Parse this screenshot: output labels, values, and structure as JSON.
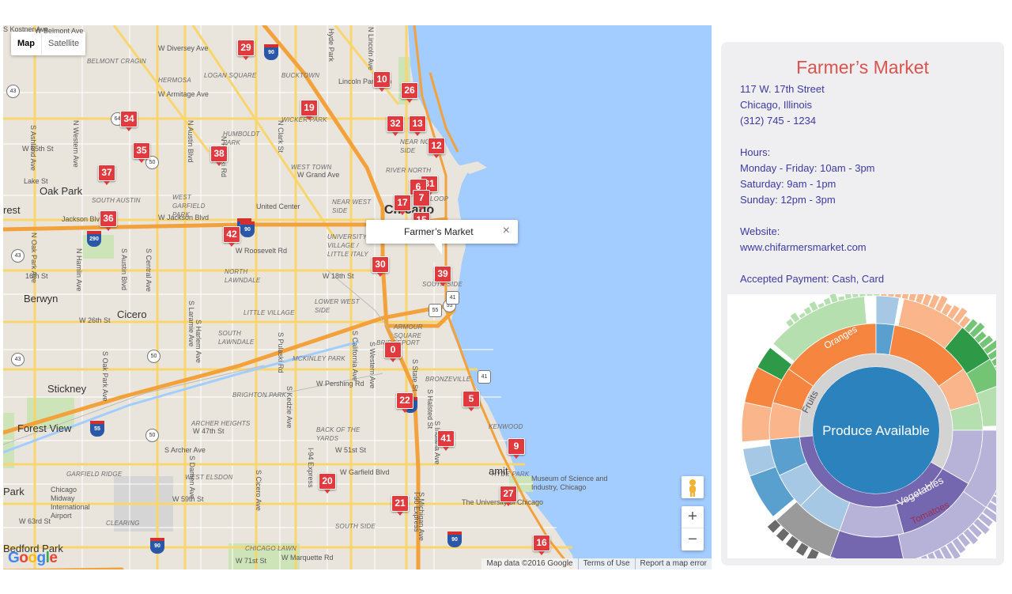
{
  "map": {
    "type_controls": {
      "map": "Map",
      "satellite": "Satellite"
    },
    "infowindow": {
      "title": "Farmer’s Market",
      "close": "×"
    },
    "zoom_in": "+",
    "zoom_out": "−",
    "footer": {
      "data": "Map data ©2016 Google",
      "terms": "Terms of Use",
      "report": "Report a map error"
    },
    "logo": "Google",
    "places": [
      {
        "t": "W Belmont Ave",
        "c": "md"
      },
      {
        "t": "W Diversey Ave",
        "c": "md"
      },
      {
        "t": "BELMONT CRAGIN",
        "c": "sm"
      },
      {
        "t": "HERMOSA",
        "c": "sm"
      },
      {
        "t": "LOGAN SQUARE",
        "c": "sm"
      },
      {
        "t": "BUCKTOWN",
        "c": "sm"
      },
      {
        "t": "W Armitage Ave",
        "c": "md"
      },
      {
        "t": "Lincoln Park Zoo",
        "c": "md"
      },
      {
        "t": "WICKER PARK",
        "c": "sm"
      },
      {
        "t": "HUMBOLDT PARK",
        "c": "sm"
      },
      {
        "t": "NEAR NORTH SIDE",
        "c": "sm"
      },
      {
        "t": "WEST TOWN",
        "c": "sm"
      },
      {
        "t": "W Grand Ave",
        "c": "md"
      },
      {
        "t": "RIVER NORTH",
        "c": "sm"
      },
      {
        "t": "Oak Park",
        "c": "lg"
      },
      {
        "t": "Lake St",
        "c": "md"
      },
      {
        "t": "SOUTH AUSTIN",
        "c": "sm"
      },
      {
        "t": "WEST GARFIELD PARK",
        "c": "sm"
      },
      {
        "t": "United Center",
        "c": "md"
      },
      {
        "t": "NEAR WEST SIDE",
        "c": "sm"
      },
      {
        "t": "Chicago",
        "c": "xl"
      },
      {
        "t": "LOOP",
        "c": "sm"
      },
      {
        "t": "Jackson Blvd",
        "c": "md"
      },
      {
        "t": "W Jackson Blvd",
        "c": "md"
      },
      {
        "t": "UNIVERSITY VILLAGE / LITTLE ITALY",
        "c": "sm"
      },
      {
        "t": "W Roosevelt Rd",
        "c": "md"
      },
      {
        "t": "NORTH LAWNDALE",
        "c": "sm"
      },
      {
        "t": "16th St",
        "c": "md"
      },
      {
        "t": "W 18th St",
        "c": "md"
      },
      {
        "t": "SOUTH SIDE",
        "c": "sm"
      },
      {
        "t": "Berwyn",
        "c": "lg"
      },
      {
        "t": "LOWER WEST SIDE",
        "c": "sm"
      },
      {
        "t": "W 26th St",
        "c": "md"
      },
      {
        "t": "Cicero",
        "c": "lg"
      },
      {
        "t": "LITTLE VILLAGE",
        "c": "sm"
      },
      {
        "t": "SOUTH LAWNDALE",
        "c": "sm"
      },
      {
        "t": "ARMOUR SQUARE",
        "c": "sm"
      },
      {
        "t": "BRIDGEPORT",
        "c": "sm"
      },
      {
        "t": "MCKINLEY PARK",
        "c": "sm"
      },
      {
        "t": "W Pershing Rd",
        "c": "md"
      },
      {
        "t": "BRONZEVILLE",
        "c": "sm"
      },
      {
        "t": "Stickney",
        "c": "lg"
      },
      {
        "t": "BRIGHTON PARK",
        "c": "sm"
      },
      {
        "t": "ARCHER HEIGHTS",
        "c": "sm"
      },
      {
        "t": "W 47th St",
        "c": "md"
      },
      {
        "t": "BACK OF THE YARDS",
        "c": "sm"
      },
      {
        "t": "Forest View",
        "c": "lg"
      },
      {
        "t": "S Archer Ave",
        "c": "md"
      },
      {
        "t": "W 51st St",
        "c": "md"
      },
      {
        "t": "KENWOOD",
        "c": "sm"
      },
      {
        "t": "GARFIELD RIDGE",
        "c": "sm"
      },
      {
        "t": "WEST ELSDON",
        "c": "sm"
      },
      {
        "t": "W Garfield Blvd",
        "c": "md"
      },
      {
        "t": "HYDE PARK",
        "c": "sm"
      },
      {
        "t": "Chicago Midway International Airport",
        "c": "md"
      },
      {
        "t": "W 59th St",
        "c": "md"
      },
      {
        "t": "Museum of Science and Industry, Chicago",
        "c": "md"
      },
      {
        "t": "The University of Chicago",
        "c": "md"
      },
      {
        "t": "W 63rd St",
        "c": "md"
      },
      {
        "t": "CLEARING",
        "c": "sm"
      },
      {
        "t": "SOUTH SIDE",
        "c": "sm"
      },
      {
        "t": "W Marquette Rd",
        "c": "md"
      },
      {
        "t": "CHICAGO LAWN",
        "c": "sm"
      },
      {
        "t": "W 71st St",
        "c": "md"
      },
      {
        "t": "Bedford Park",
        "c": "lg"
      },
      {
        "t": "W 65th St",
        "c": "md"
      },
      {
        "t": "rest",
        "c": "lg"
      },
      {
        "t": "Park",
        "c": "lg"
      },
      {
        "t": "amit",
        "c": "lg"
      },
      {
        "t": "Hyde Park",
        "c": "md"
      },
      {
        "t": "N Lincoln Ave",
        "c": "md"
      },
      {
        "t": "N Clark St",
        "c": "md"
      },
      {
        "t": "N Western Ave",
        "c": "md"
      },
      {
        "t": "N Austin Blvd",
        "c": "md"
      },
      {
        "t": "N Pulaski Rd",
        "c": "md"
      },
      {
        "t": "N Hamlin Ave",
        "c": "md"
      },
      {
        "t": "S Austin Blvd",
        "c": "md"
      },
      {
        "t": "S Central Ave",
        "c": "md"
      },
      {
        "t": "S Laramie Ave",
        "c": "md"
      },
      {
        "t": "S Pulaski Rd",
        "c": "md"
      },
      {
        "t": "S Kedzie Ave",
        "c": "md"
      },
      {
        "t": "S Western Ave",
        "c": "md"
      },
      {
        "t": "S Halsted St",
        "c": "md"
      },
      {
        "t": "S Indiana Ave",
        "c": "md"
      },
      {
        "t": "S Michigan Ave",
        "c": "md"
      },
      {
        "t": "S State St",
        "c": "md"
      },
      {
        "t": "I-90 Express",
        "c": "md"
      },
      {
        "t": "I-94 Express",
        "c": "md"
      },
      {
        "t": "S Damen Ave",
        "c": "md"
      },
      {
        "t": "S Cicero Ave",
        "c": "md"
      },
      {
        "t": "S California Ave",
        "c": "md"
      },
      {
        "t": "S Ashland Ave",
        "c": "md"
      },
      {
        "t": "N Oak Park Ave",
        "c": "md"
      },
      {
        "t": "S Oak Park Ave",
        "c": "md"
      },
      {
        "t": "S Harlem Ave",
        "c": "md"
      },
      {
        "t": "S Kostner Ave",
        "c": "md"
      }
    ],
    "shields": [
      "43",
      "64",
      "50",
      "43",
      "43",
      "50",
      "50",
      "55"
    ],
    "interstates": [
      "90",
      "290",
      "290",
      "90",
      "90",
      "55",
      "90",
      "90"
    ],
    "us_routes": [
      "41",
      "41",
      "55"
    ],
    "markers": [
      "29",
      "10",
      "26",
      "19",
      "34",
      "32",
      "13",
      "35",
      "38",
      "12",
      "37",
      "31",
      "6",
      "7",
      "17",
      "15",
      "36",
      "42",
      "30",
      "39",
      "0",
      "22",
      "5",
      "41",
      "9",
      "20",
      "27",
      "21",
      "16"
    ]
  },
  "panel": {
    "title": "Farmer’s Market",
    "address": [
      "117 W. 17th Street",
      "Chicago, Illinois",
      "(312) 745 - 1234"
    ],
    "hours_label": "Hours:",
    "hours": [
      "Monday - Friday: 10am - 3pm",
      "Saturday: 9am - 1pm",
      "Sunday: 12pm - 3pm"
    ],
    "website_label": "Website:",
    "website": "www.chifarmersmarket.com",
    "payment": "Accepted Payment: Cash, Card"
  },
  "sunburst": {
    "center": "Produce Available",
    "ring1": [
      {
        "label": "Fruits",
        "color": "#cfcfcf"
      },
      {
        "label": "Vegetables",
        "color": "#7467b0"
      }
    ],
    "ring2": [
      {
        "label": "Oranges",
        "color": "#f5853f"
      },
      {
        "label": "Tomatoes",
        "color": "#9c96c8"
      }
    ],
    "colors": {
      "center": "#2b82bd",
      "fruits": "#d3d3d3",
      "oranges": "#f5853f",
      "peach": "#fbb58a",
      "green": "#74c476",
      "ltgreen": "#b6dfb0",
      "dkgreen": "#2e9a47",
      "blue": "#5aa0cf",
      "ltblue": "#a6c8e4",
      "purple": "#7467b0",
      "ltpurple": "#b7b2d8",
      "gray": "#9a9a9a",
      "dkgray": "#6a6a6a"
    }
  }
}
